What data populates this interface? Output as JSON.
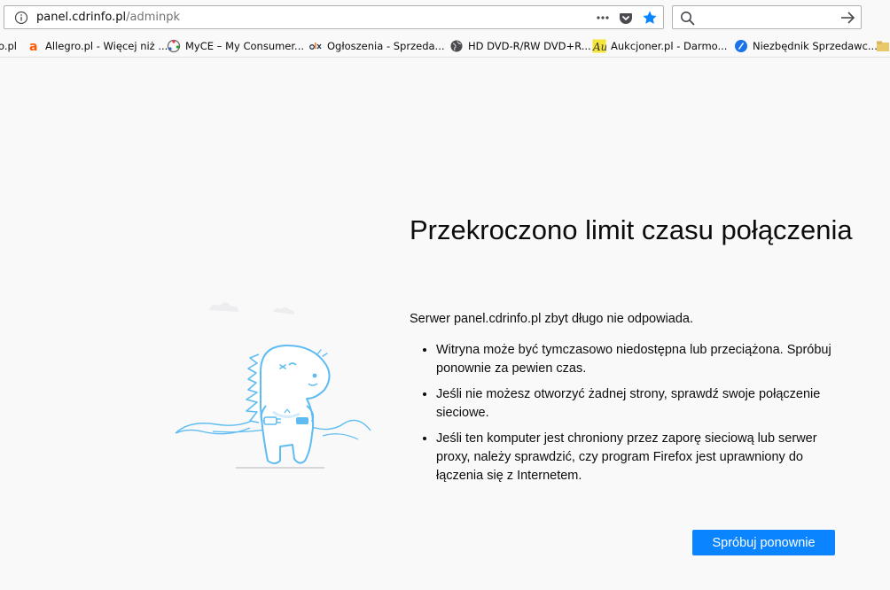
{
  "urlbar": {
    "url_host": "panel.cdrinfo.pl",
    "url_path": "/adminpk",
    "info_icon": "info-icon",
    "page_actions_icon": "page-actions-icon",
    "pocket_icon": "pocket-icon",
    "bookmark_star_icon": "star-icon"
  },
  "searchbar": {
    "placeholder": "",
    "search_icon": "search-icon",
    "go_icon": "arrow-right-icon"
  },
  "bookmarks": [
    {
      "label": "o.pl",
      "icon": "partial-favicon"
    },
    {
      "label": "Allegro.pl - Więcej niż ...",
      "icon": "allegro-favicon",
      "color": "#ff5a00"
    },
    {
      "label": "MyCE – My Consumer...",
      "icon": "myce-favicon"
    },
    {
      "label": "Ogłoszenia - Sprzeda...",
      "icon": "olx-favicon"
    },
    {
      "label": "HD DVD-R/RW DVD+R...",
      "icon": "globe-favicon"
    },
    {
      "label": "Aukcjoner.pl - Darmo...",
      "icon": "aukcjoner-favicon"
    },
    {
      "label": "Niezbędnik Sprzedawc...",
      "icon": "niezbednik-favicon",
      "color": "#1a73e8"
    }
  ],
  "error_page": {
    "title": "Przekroczono limit czasu połączenia",
    "description": "Serwer panel.cdrinfo.pl zbyt długo nie odpowiada.",
    "reasons": [
      "Witryna może być tymczasowo niedostępna lub przeciążona. Spróbuj ponownie za pewien czas.",
      "Jeśli nie możesz otworzyć żadnej strony, sprawdź swoje połączenie sieciowe.",
      "Jeśli ten komputer jest chroniony przez zaporę sieciową lub serwer proxy, należy sprawdzić, czy program Firefox jest uprawniony do łączenia się z Internetem."
    ],
    "retry_label": "Spróbuj ponownie",
    "accent_color": "#0a84ff"
  }
}
